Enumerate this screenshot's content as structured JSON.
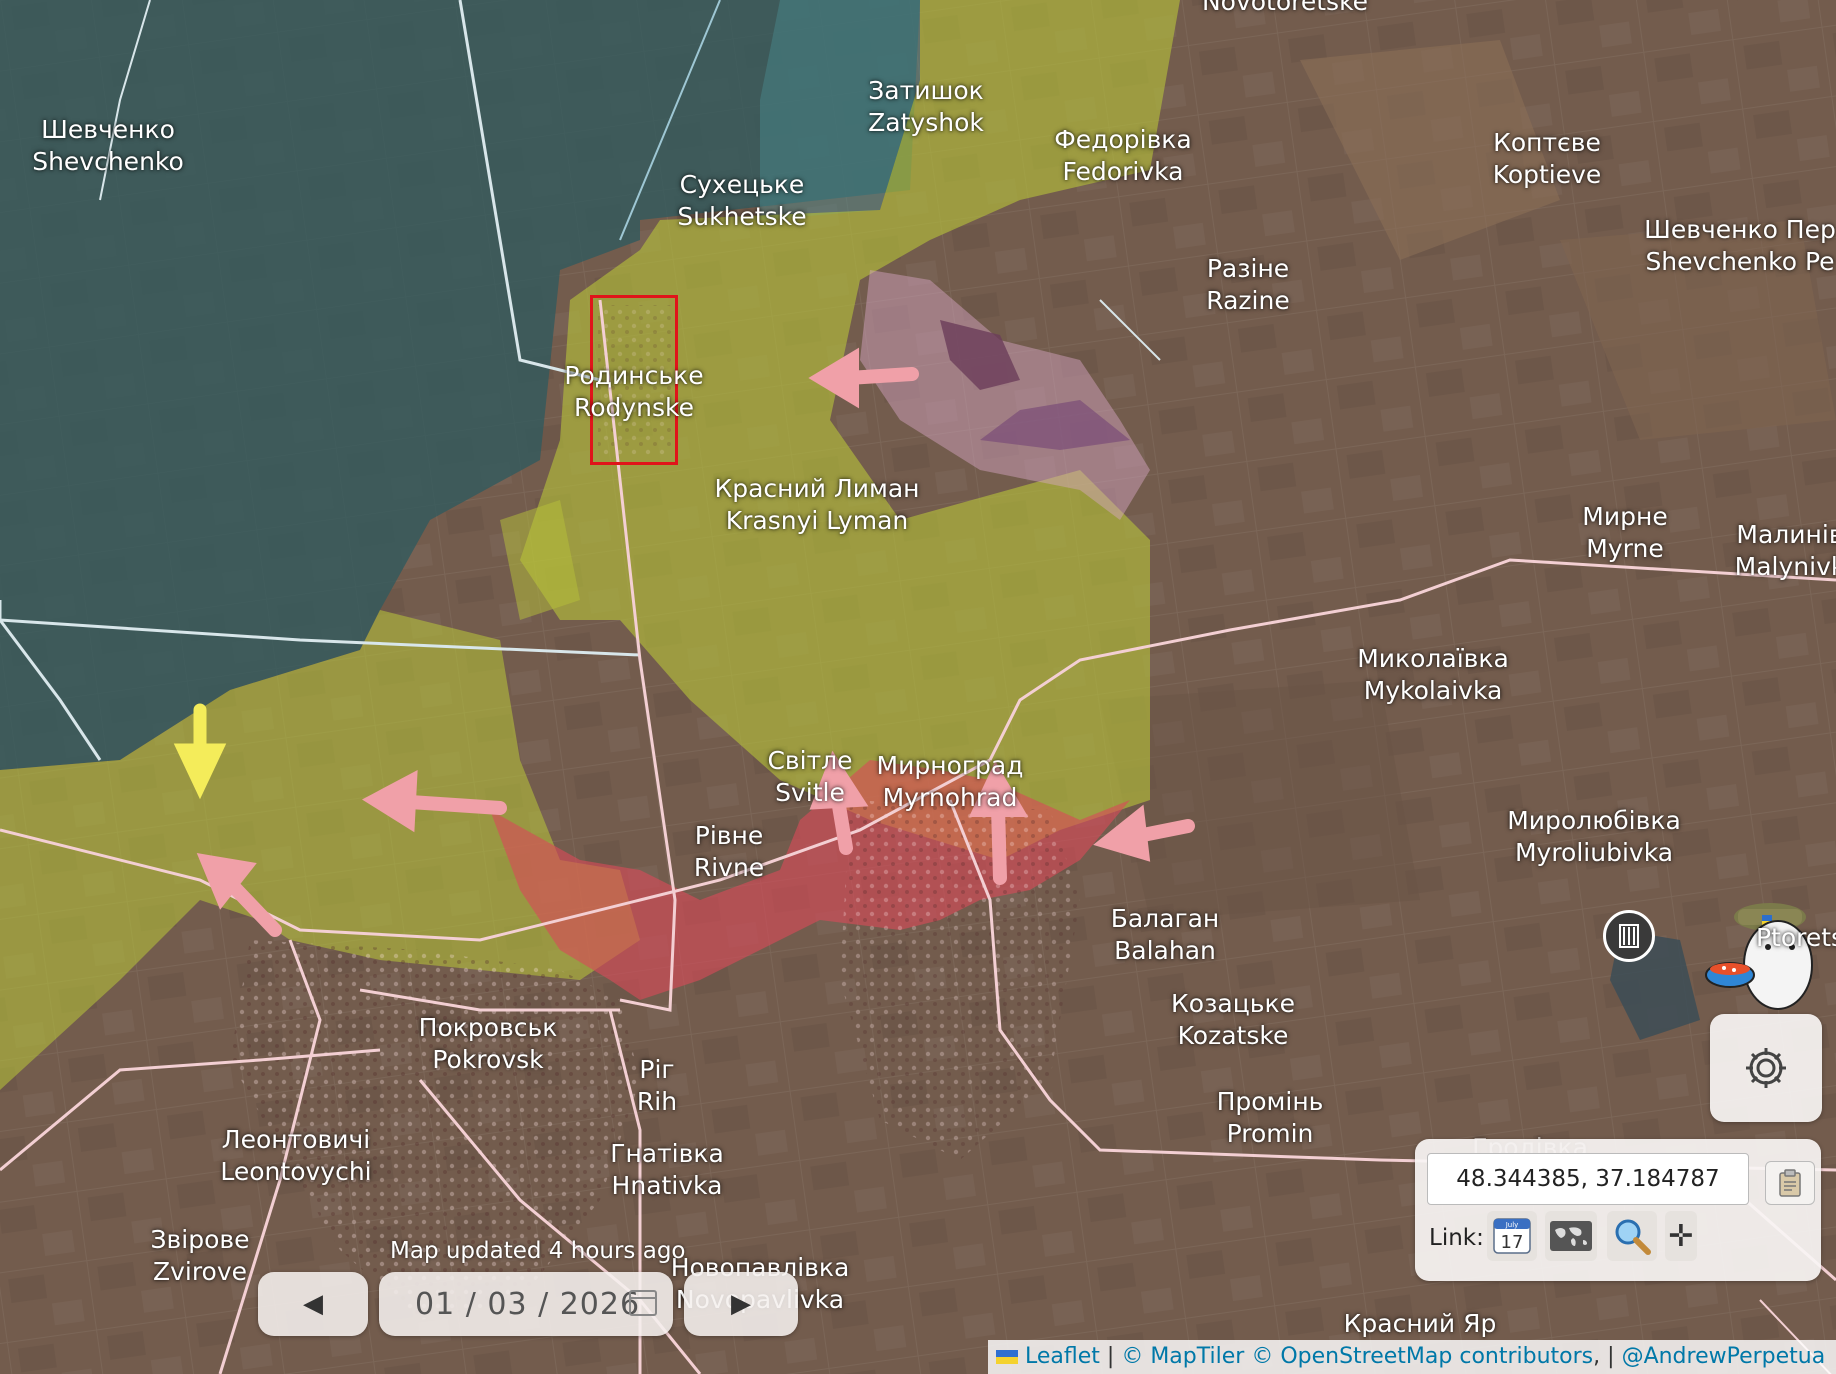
{
  "map": {
    "places": [
      {
        "id": "novotoretske",
        "uk": "",
        "en": "Novotoretske"
      },
      {
        "id": "shevchenko",
        "uk": "Шевченко",
        "en": "Shevchenko"
      },
      {
        "id": "zatyshok",
        "uk": "Затишок",
        "en": "Zatyshok"
      },
      {
        "id": "sukhetske",
        "uk": "Сухецьке",
        "en": "Sukhetske"
      },
      {
        "id": "fedorivka",
        "uk": "Федорівка",
        "en": "Fedorivka"
      },
      {
        "id": "koptieve",
        "uk": "Коптєве",
        "en": "Koptieve"
      },
      {
        "id": "shevchenko-pershe",
        "uk": "Шевченко Пер",
        "en": "Shevchenko Pe"
      },
      {
        "id": "razine",
        "uk": "Разіне",
        "en": "Razine"
      },
      {
        "id": "rodynske",
        "uk": "Родинське",
        "en": "Rodynske"
      },
      {
        "id": "krasnyi-lyman",
        "uk": "Красний Лиман",
        "en": "Krasnyi Lyman"
      },
      {
        "id": "myrne",
        "uk": "Мирне",
        "en": "Myrne"
      },
      {
        "id": "malynivka",
        "uk": "Малинів",
        "en": "Malynivk"
      },
      {
        "id": "mykolaivka",
        "uk": "Миколаївка",
        "en": "Mykolaivka"
      },
      {
        "id": "svitle",
        "uk": "Світле",
        "en": "Svitle"
      },
      {
        "id": "myrnohrad",
        "uk": "Мирноград",
        "en": "Myrnohrad"
      },
      {
        "id": "myroliubivka",
        "uk": "Миролюбівка",
        "en": "Myroliubivka"
      },
      {
        "id": "rivne",
        "uk": "Рівне",
        "en": "Rivne"
      },
      {
        "id": "balahan",
        "uk": "Балаган",
        "en": "Balahan"
      },
      {
        "id": "kozatske",
        "uk": "Козацьке",
        "en": "Kozatske"
      },
      {
        "id": "pokrovsk",
        "uk": "Покровськ",
        "en": "Pokrovsk"
      },
      {
        "id": "rih",
        "uk": "Ріг",
        "en": "Rih"
      },
      {
        "id": "promin",
        "uk": "Промінь",
        "en": "Promin"
      },
      {
        "id": "leontovychi",
        "uk": "Леонтовичі",
        "en": "Leontovychi"
      },
      {
        "id": "hnativka",
        "uk": "Гнатівка",
        "en": "Hnativka"
      },
      {
        "id": "zvirove",
        "uk": "Звірове",
        "en": "Zvirove"
      },
      {
        "id": "novopavlivka",
        "uk": "Новопавлівка",
        "en": "Novopavlivka"
      },
      {
        "id": "krasnyi-yar",
        "uk": "Красний Яр",
        "en": ""
      },
      {
        "id": "hrodivka",
        "uk": "Гродівка",
        "en": ""
      },
      {
        "id": "ptorets",
        "uk": "",
        "en": "Ptorets"
      }
    ],
    "colors": {
      "ukraine_controlled": "#2f5a5e",
      "gray_zone": "#b7c23a",
      "russia_advance": "#d94a58",
      "arrow_russian": "#f0a0a8",
      "arrow_ukrainian": "#f4ec5a",
      "road": "#f3cfd3",
      "border": "#d8e6ea",
      "selection": "#e0141a"
    }
  },
  "status": {
    "map_updated": "Map updated 4 hours ago"
  },
  "timeline": {
    "prev_icon": "◀",
    "date": "01 / 03 / 2026",
    "next_icon": "▶",
    "calendar_icon": "calendar-icon"
  },
  "coords": {
    "value": "48.344385, 37.184787",
    "copy_icon": "clipboard-icon"
  },
  "links": {
    "label": "Link:",
    "buttons": [
      {
        "name": "calendar-link",
        "icon": "calendar-17-icon",
        "text": "17",
        "month": "July"
      },
      {
        "name": "map-link",
        "icon": "world-map-icon"
      },
      {
        "name": "zoom-link",
        "icon": "magnifier-icon"
      },
      {
        "name": "crosshair-link",
        "icon": "crosshair-icon",
        "glyph": "✛"
      }
    ]
  },
  "settings": {
    "icon": "gear-icon"
  },
  "attribution": {
    "leaflet": "Leaflet",
    "separator": "|",
    "maptiler": "© MapTiler",
    "osm": "© OpenStreetMap contributors",
    "comma": ",",
    "author": "@AndrewPerpetua"
  }
}
